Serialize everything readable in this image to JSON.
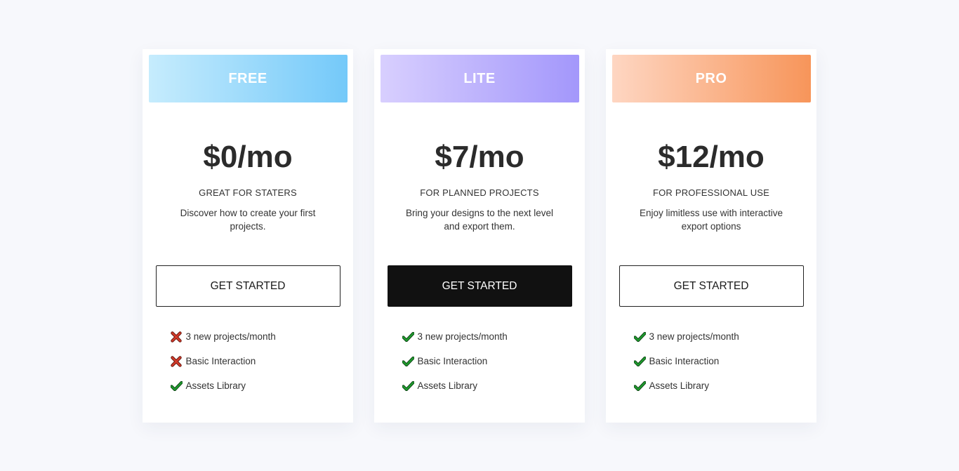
{
  "plans": [
    {
      "name": "FREE",
      "price": "$0/mo",
      "tagline": "GREAT FOR STATERS",
      "description": "Discover how to create your first projects.",
      "cta": "GET STARTED",
      "header_gradient": [
        "#c6ecfd",
        "#74c9f9"
      ],
      "cta_style": "outline",
      "features": [
        {
          "label": "3 new projects/month",
          "included": false,
          "icon": "cross-icon"
        },
        {
          "label": "Basic Interaction",
          "included": false,
          "icon": "cross-icon"
        },
        {
          "label": "Assets Library",
          "included": true,
          "icon": "check-icon"
        }
      ]
    },
    {
      "name": "LITE",
      "price": "$7/mo",
      "tagline": "FOR PLANNED PROJECTS",
      "description": "Bring your designs to the next level and export them.",
      "cta": "GET STARTED",
      "header_gradient": [
        "#d8cffe",
        "#a397fb"
      ],
      "cta_style": "filled",
      "features": [
        {
          "label": "3 new projects/month",
          "included": true,
          "icon": "check-icon"
        },
        {
          "label": "Basic Interaction",
          "included": true,
          "icon": "check-icon"
        },
        {
          "label": "Assets Library",
          "included": true,
          "icon": "check-icon"
        }
      ]
    },
    {
      "name": "PRO",
      "price": "$12/mo",
      "tagline": "FOR PROFESSIONAL USE",
      "description": "Enjoy limitless use with interactive export options",
      "cta": "GET STARTED",
      "header_gradient": [
        "#fed6c2",
        "#f7955a"
      ],
      "cta_style": "outline",
      "features": [
        {
          "label": "3 new projects/month",
          "included": true,
          "icon": "check-icon"
        },
        {
          "label": "Basic Interaction",
          "included": true,
          "icon": "check-icon"
        },
        {
          "label": "Assets Library",
          "included": true,
          "icon": "check-icon"
        }
      ]
    }
  ],
  "colors": {
    "page_background": "#f7f8fc",
    "check": "#1f9b2e",
    "cross": "#d23a2a"
  }
}
